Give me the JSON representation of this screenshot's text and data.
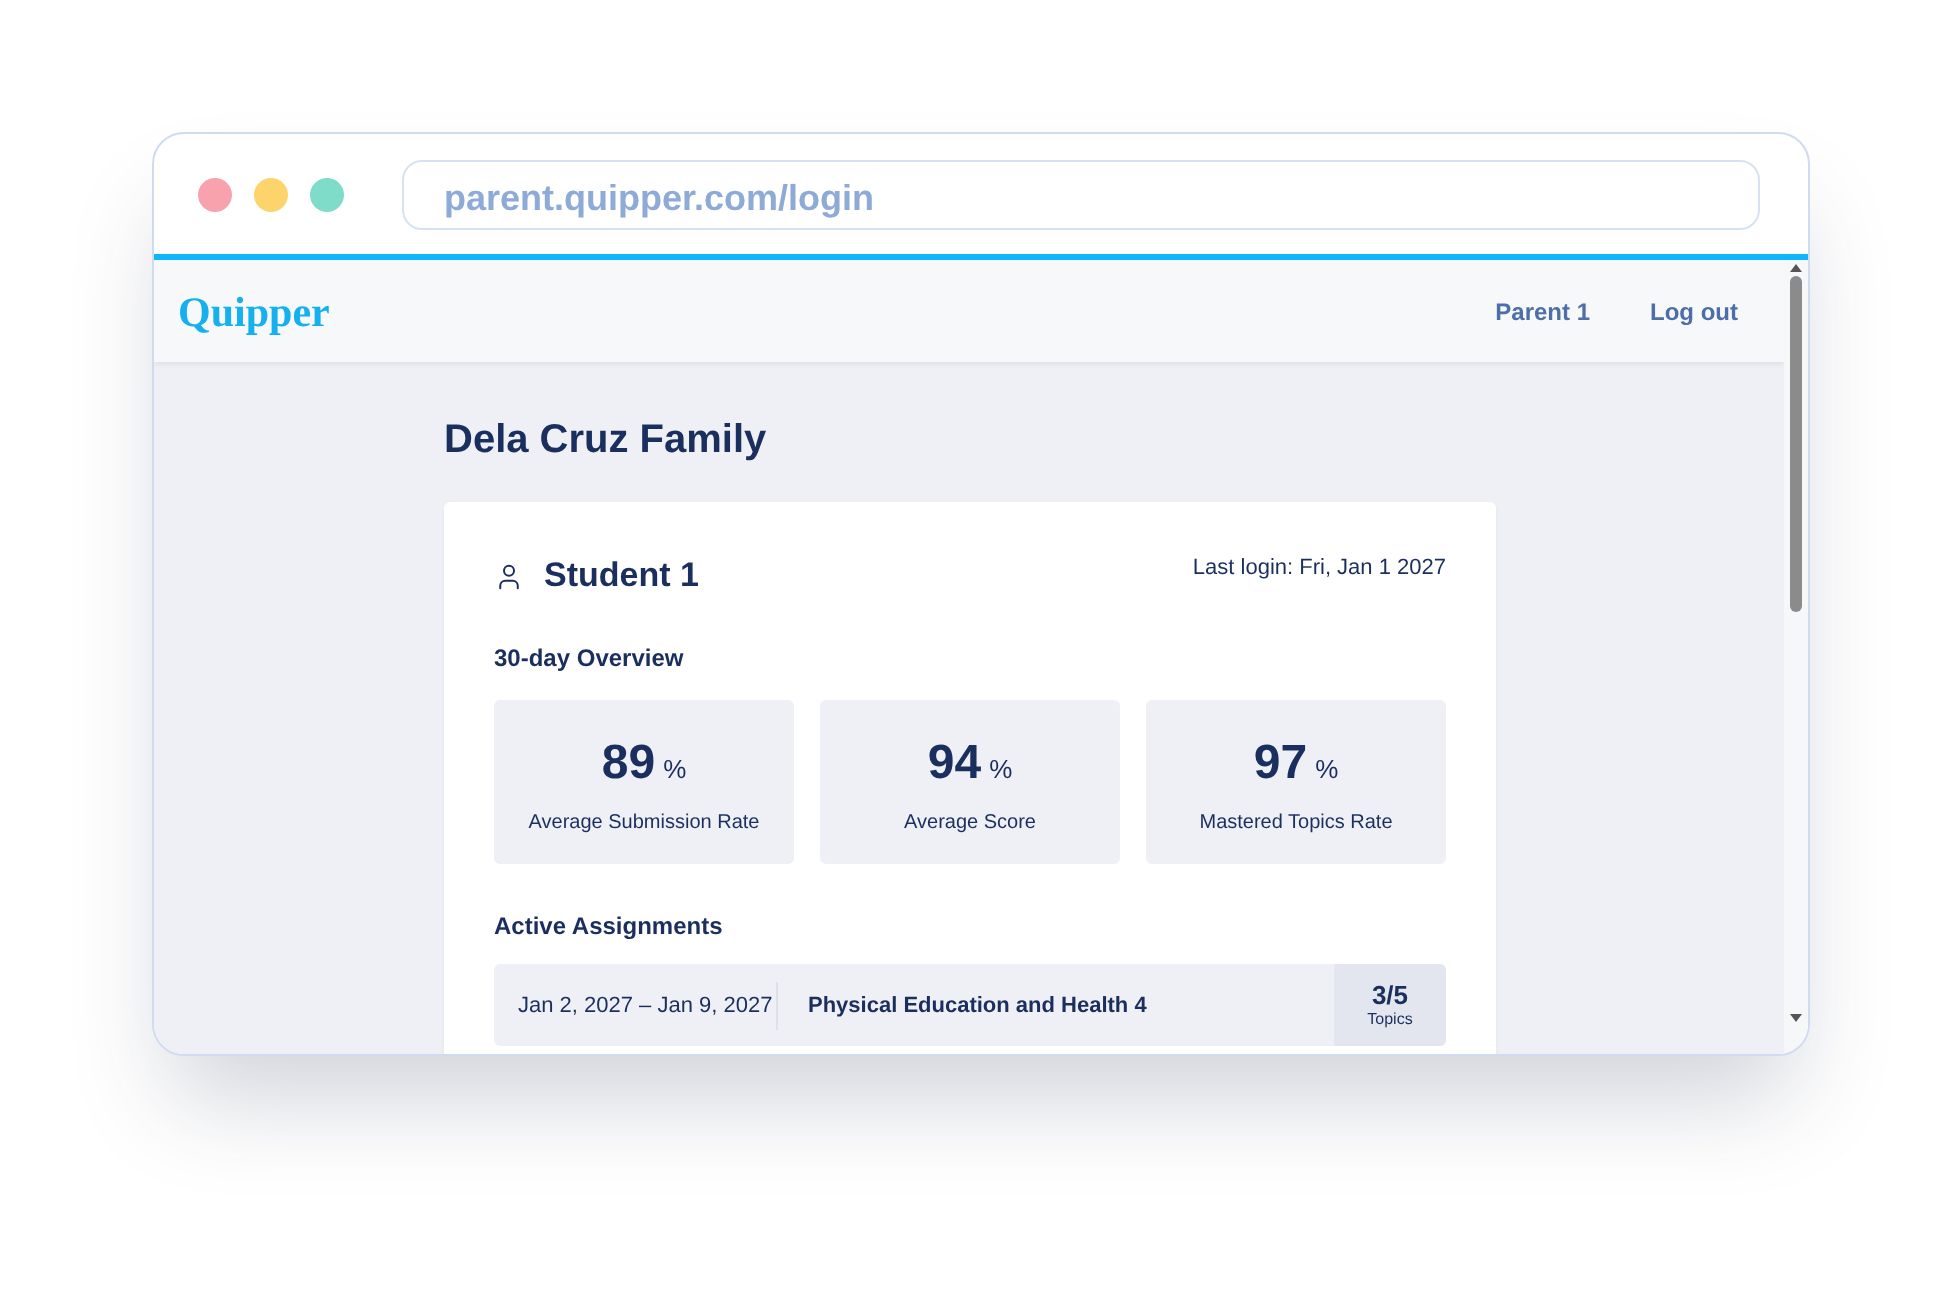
{
  "browser": {
    "url": "parent.quipper.com/login"
  },
  "header": {
    "logo": "Quipper",
    "nav": [
      {
        "label": "Parent 1"
      },
      {
        "label": "Log out"
      }
    ]
  },
  "page": {
    "title": "Dela Cruz Family"
  },
  "student": {
    "name": "Student 1",
    "last_login": "Last login: Fri, Jan 1 2027"
  },
  "overview": {
    "heading": "30-day Overview",
    "stats": [
      {
        "value": "89",
        "unit": "%",
        "label": "Average Submission Rate"
      },
      {
        "value": "94",
        "unit": "%",
        "label": "Average Score"
      },
      {
        "value": "97",
        "unit": "%",
        "label": "Mastered Topics Rate"
      }
    ]
  },
  "assignments": {
    "heading": "Active Assignments",
    "rows": [
      {
        "dates": "Jan 2, 2027 – Jan 9, 2027",
        "subject": "Physical Education and Health 4",
        "progress": "3/5",
        "progress_label": "Topics"
      }
    ]
  }
}
